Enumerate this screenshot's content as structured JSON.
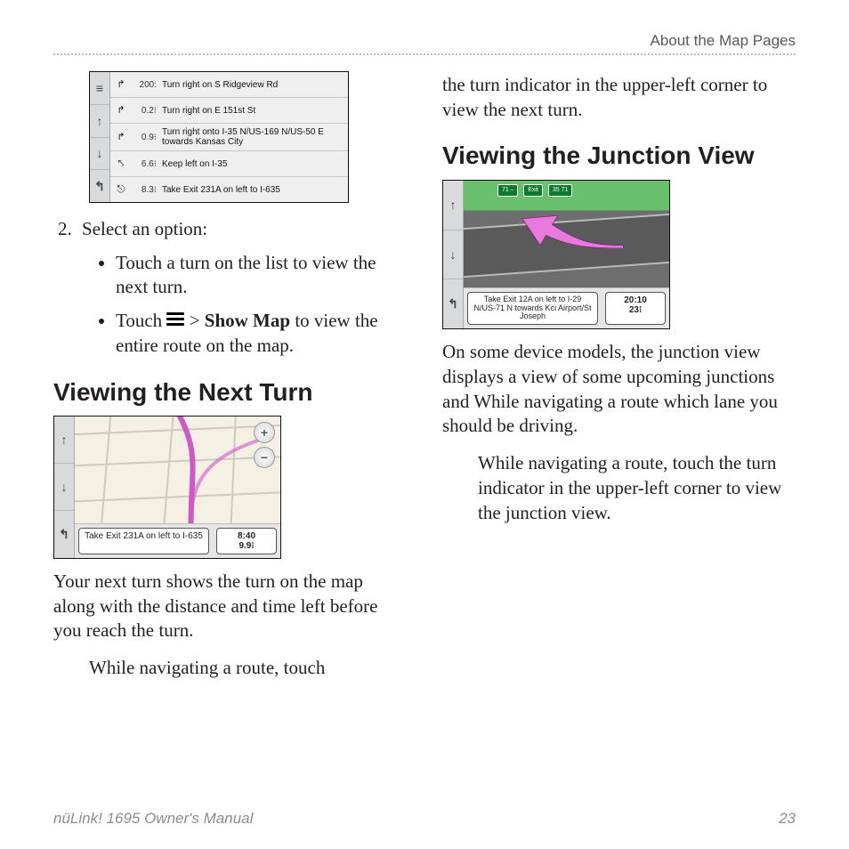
{
  "header": {
    "running": "About the Map Pages"
  },
  "footer": {
    "left": "nüLink! 1695 Owner's Manual",
    "right": "23"
  },
  "left": {
    "turnlist": {
      "side_icons": [
        "≡",
        "↑",
        "↓",
        "↰"
      ],
      "rows": [
        {
          "icon": "↱",
          "dist": "200:",
          "text": "Turn right on S Ridgeview Rd"
        },
        {
          "icon": "↱",
          "dist": "0.2⁝",
          "text": "Turn right on E 151st St"
        },
        {
          "icon": "↱",
          "dist": "0.9⁝",
          "text": "Turn right onto I-35 N/US-169 N/US-50 E towards Kansas City"
        },
        {
          "icon": "⤣",
          "dist": "6.6⁝",
          "text": "Keep left on I-35"
        },
        {
          "icon": "⎋",
          "dist": "8.3⁝",
          "text": "Take Exit 231A on left to I-635"
        }
      ]
    },
    "step2_intro": "Select an option:",
    "bullet1": "Touch a turn on the list to view the next turn.",
    "bullet2_a": "Touch ",
    "bullet2_b": " > ",
    "bullet2_bold": "Show Map",
    "bullet2_c": " to view the entire route on the map.",
    "h_next": "Viewing the Next Turn",
    "map1": {
      "side_icons": [
        "↑",
        "↓",
        "↰"
      ],
      "instr": "Take Exit 231A on left to I-635",
      "time": "8:40",
      "dist": "9.9⁝"
    },
    "para_next": "Your next turn shows the turn on the map along with the distance and time left before you reach the turn.",
    "para_next_tail": "While navigating a route, touch"
  },
  "right": {
    "cont": "the turn indicator in the upper-left corner to view the next turn.",
    "h_junction": "Viewing the Junction View",
    "map2": {
      "side_icons": [
        "↑",
        "↓",
        "↰"
      ],
      "signs": [
        "71  ⎯",
        "Exit",
        "35  71"
      ],
      "instr": "Take Exit 12A on left to I-29 N/US-71 N towards Kci Airport/St Joseph",
      "time": "20:10",
      "dist": "23⁝"
    },
    "para_j1": "On some device models, the junction view displays a view of some upcoming junctions and While navigating a route which lane you should be driving.",
    "para_j2": "While navigating a route, touch the turn indicator in the upper-left corner to view the junction view."
  }
}
